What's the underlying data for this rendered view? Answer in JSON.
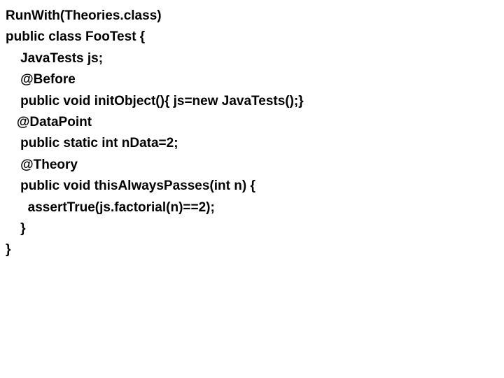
{
  "code": {
    "line1": "RunWith(Theories.class)",
    "line2": "public class FooTest {",
    "line3": "    JavaTests js;",
    "line4": "    @Before",
    "line5": "    public void initObject(){ js=new JavaTests();}",
    "line6": "",
    "line7": "   @DataPoint",
    "line8": "    public static int nData=2;",
    "line9": "",
    "line10": "    @Theory",
    "line11": "    public void thisAlwaysPasses(int n) {",
    "line12": "      assertTrue(js.factorial(n)==2);",
    "line13": "    }",
    "line14": "}"
  }
}
